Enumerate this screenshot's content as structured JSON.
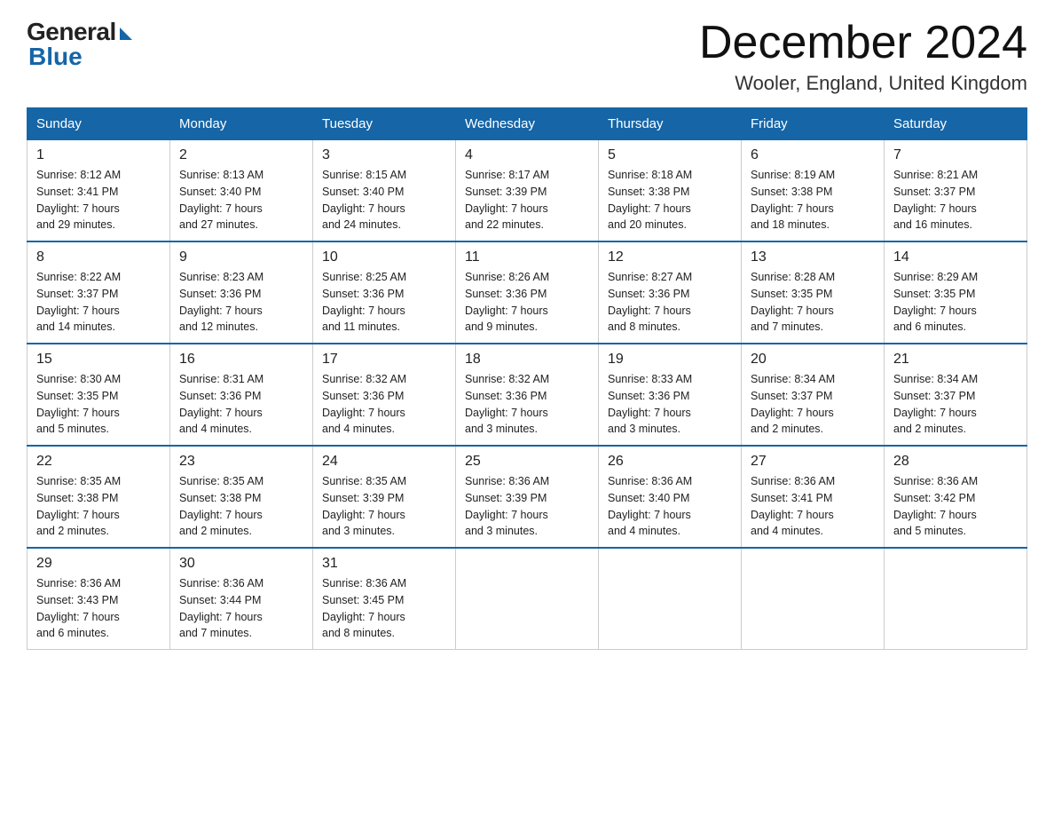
{
  "logo": {
    "general": "General",
    "blue": "Blue"
  },
  "header": {
    "title": "December 2024",
    "subtitle": "Wooler, England, United Kingdom"
  },
  "days_header": [
    "Sunday",
    "Monday",
    "Tuesday",
    "Wednesday",
    "Thursday",
    "Friday",
    "Saturday"
  ],
  "weeks": [
    [
      {
        "num": "1",
        "sunrise": "8:12 AM",
        "sunset": "3:41 PM",
        "daylight": "7 hours and 29 minutes."
      },
      {
        "num": "2",
        "sunrise": "8:13 AM",
        "sunset": "3:40 PM",
        "daylight": "7 hours and 27 minutes."
      },
      {
        "num": "3",
        "sunrise": "8:15 AM",
        "sunset": "3:40 PM",
        "daylight": "7 hours and 24 minutes."
      },
      {
        "num": "4",
        "sunrise": "8:17 AM",
        "sunset": "3:39 PM",
        "daylight": "7 hours and 22 minutes."
      },
      {
        "num": "5",
        "sunrise": "8:18 AM",
        "sunset": "3:38 PM",
        "daylight": "7 hours and 20 minutes."
      },
      {
        "num": "6",
        "sunrise": "8:19 AM",
        "sunset": "3:38 PM",
        "daylight": "7 hours and 18 minutes."
      },
      {
        "num": "7",
        "sunrise": "8:21 AM",
        "sunset": "3:37 PM",
        "daylight": "7 hours and 16 minutes."
      }
    ],
    [
      {
        "num": "8",
        "sunrise": "8:22 AM",
        "sunset": "3:37 PM",
        "daylight": "7 hours and 14 minutes."
      },
      {
        "num": "9",
        "sunrise": "8:23 AM",
        "sunset": "3:36 PM",
        "daylight": "7 hours and 12 minutes."
      },
      {
        "num": "10",
        "sunrise": "8:25 AM",
        "sunset": "3:36 PM",
        "daylight": "7 hours and 11 minutes."
      },
      {
        "num": "11",
        "sunrise": "8:26 AM",
        "sunset": "3:36 PM",
        "daylight": "7 hours and 9 minutes."
      },
      {
        "num": "12",
        "sunrise": "8:27 AM",
        "sunset": "3:36 PM",
        "daylight": "7 hours and 8 minutes."
      },
      {
        "num": "13",
        "sunrise": "8:28 AM",
        "sunset": "3:35 PM",
        "daylight": "7 hours and 7 minutes."
      },
      {
        "num": "14",
        "sunrise": "8:29 AM",
        "sunset": "3:35 PM",
        "daylight": "7 hours and 6 minutes."
      }
    ],
    [
      {
        "num": "15",
        "sunrise": "8:30 AM",
        "sunset": "3:35 PM",
        "daylight": "7 hours and 5 minutes."
      },
      {
        "num": "16",
        "sunrise": "8:31 AM",
        "sunset": "3:36 PM",
        "daylight": "7 hours and 4 minutes."
      },
      {
        "num": "17",
        "sunrise": "8:32 AM",
        "sunset": "3:36 PM",
        "daylight": "7 hours and 4 minutes."
      },
      {
        "num": "18",
        "sunrise": "8:32 AM",
        "sunset": "3:36 PM",
        "daylight": "7 hours and 3 minutes."
      },
      {
        "num": "19",
        "sunrise": "8:33 AM",
        "sunset": "3:36 PM",
        "daylight": "7 hours and 3 minutes."
      },
      {
        "num": "20",
        "sunrise": "8:34 AM",
        "sunset": "3:37 PM",
        "daylight": "7 hours and 2 minutes."
      },
      {
        "num": "21",
        "sunrise": "8:34 AM",
        "sunset": "3:37 PM",
        "daylight": "7 hours and 2 minutes."
      }
    ],
    [
      {
        "num": "22",
        "sunrise": "8:35 AM",
        "sunset": "3:38 PM",
        "daylight": "7 hours and 2 minutes."
      },
      {
        "num": "23",
        "sunrise": "8:35 AM",
        "sunset": "3:38 PM",
        "daylight": "7 hours and 2 minutes."
      },
      {
        "num": "24",
        "sunrise": "8:35 AM",
        "sunset": "3:39 PM",
        "daylight": "7 hours and 3 minutes."
      },
      {
        "num": "25",
        "sunrise": "8:36 AM",
        "sunset": "3:39 PM",
        "daylight": "7 hours and 3 minutes."
      },
      {
        "num": "26",
        "sunrise": "8:36 AM",
        "sunset": "3:40 PM",
        "daylight": "7 hours and 4 minutes."
      },
      {
        "num": "27",
        "sunrise": "8:36 AM",
        "sunset": "3:41 PM",
        "daylight": "7 hours and 4 minutes."
      },
      {
        "num": "28",
        "sunrise": "8:36 AM",
        "sunset": "3:42 PM",
        "daylight": "7 hours and 5 minutes."
      }
    ],
    [
      {
        "num": "29",
        "sunrise": "8:36 AM",
        "sunset": "3:43 PM",
        "daylight": "7 hours and 6 minutes."
      },
      {
        "num": "30",
        "sunrise": "8:36 AM",
        "sunset": "3:44 PM",
        "daylight": "7 hours and 7 minutes."
      },
      {
        "num": "31",
        "sunrise": "8:36 AM",
        "sunset": "3:45 PM",
        "daylight": "7 hours and 8 minutes."
      },
      null,
      null,
      null,
      null
    ]
  ],
  "labels": {
    "sunrise": "Sunrise:",
    "sunset": "Sunset:",
    "daylight": "Daylight:"
  }
}
